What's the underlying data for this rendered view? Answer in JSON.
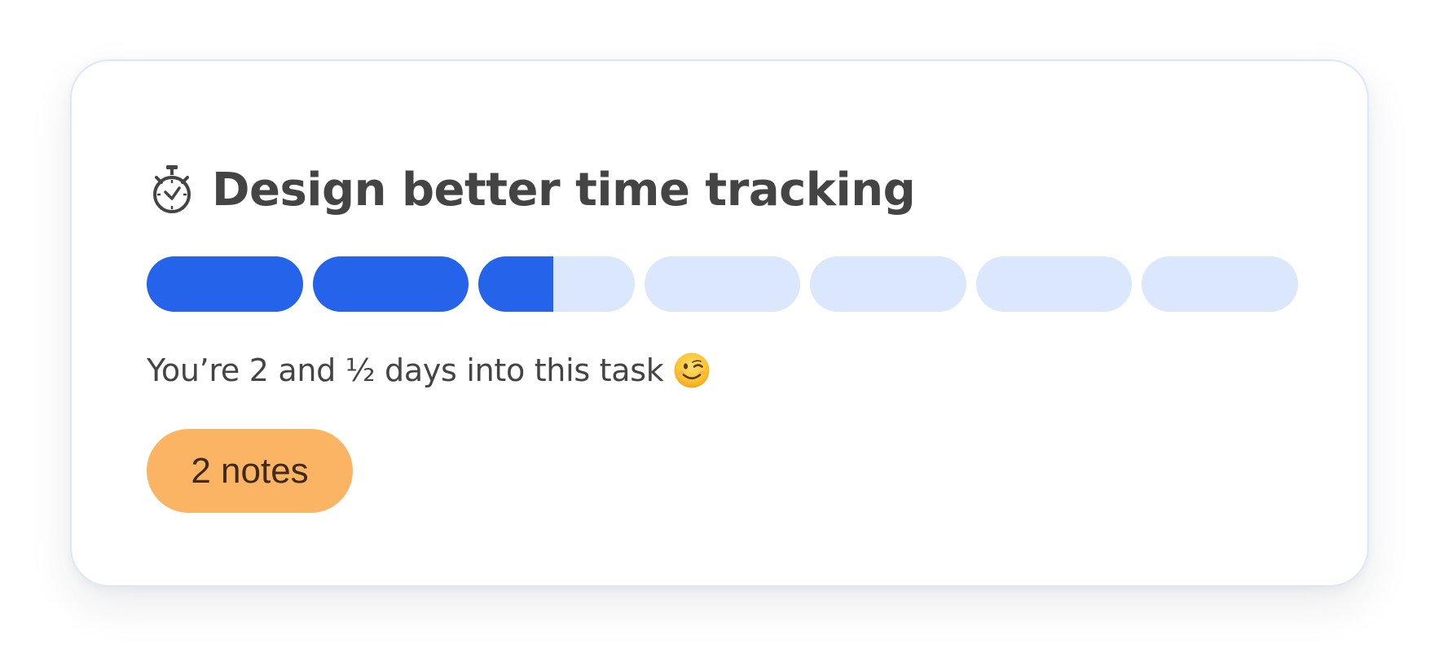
{
  "card": {
    "title": "Design better time tracking",
    "title_icon": "stopwatch-icon",
    "status_text": "You’re 2 and ½ days into this task",
    "status_emoji": "winking-face-icon",
    "notes_button_label": "2 notes"
  },
  "progress": {
    "total_segments": 7,
    "segments_fill": [
      1,
      1,
      0.48,
      0,
      0,
      0,
      0
    ],
    "days_elapsed": 2.5
  },
  "colors": {
    "accent": "#2563eb",
    "track": "#dbe7fd",
    "notes_badge": "#fbb463",
    "text": "#444444",
    "card_border": "#dbe7fb"
  }
}
